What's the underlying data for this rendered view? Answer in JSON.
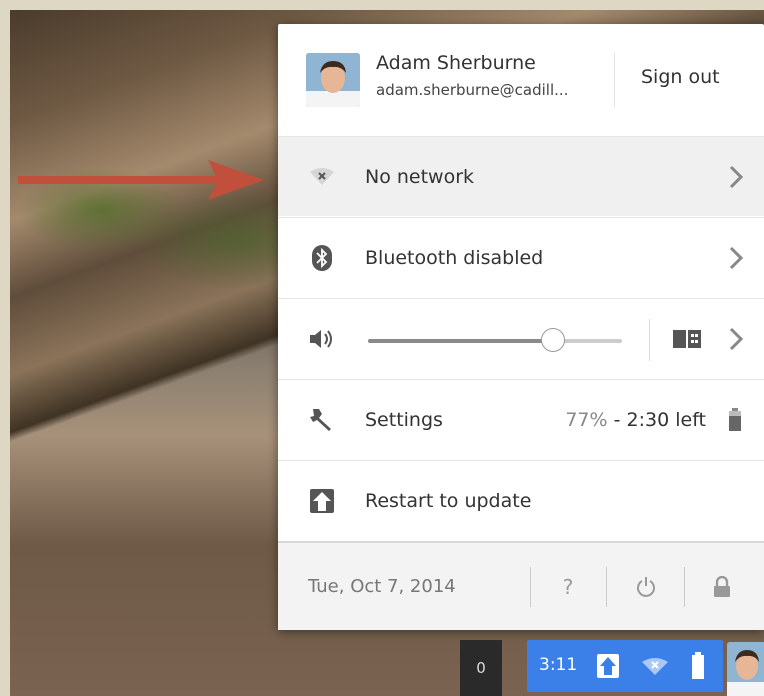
{
  "user": {
    "name": "Adam Sherburne",
    "email": "adam.sherburne@cadill...",
    "sign_out_label": "Sign out"
  },
  "network": {
    "label": "No network",
    "icon": "wifi-disconnected-icon"
  },
  "bluetooth": {
    "label": "Bluetooth disabled",
    "icon": "bluetooth-icon"
  },
  "volume": {
    "level_percent": 73,
    "icon": "speaker-icon",
    "output_icon": "audio-output-icon"
  },
  "settings": {
    "label": "Settings",
    "battery_percent": "77%",
    "battery_separator": " - ",
    "battery_time": "2:30 left",
    "icon": "wrench-icon"
  },
  "update": {
    "label": "Restart to update",
    "icon": "update-arrow-icon"
  },
  "footer": {
    "date": "Tue, Oct 7, 2014",
    "help_label": "?",
    "help_icon": "help-icon",
    "power_icon": "power-icon",
    "lock_icon": "lock-icon"
  },
  "shelf": {
    "notification_count": "0",
    "time": "3:11"
  },
  "colors": {
    "arrow": "#c0503c",
    "tray_blue": "#3a80e8",
    "highlight_row": "#f0f0f0"
  }
}
